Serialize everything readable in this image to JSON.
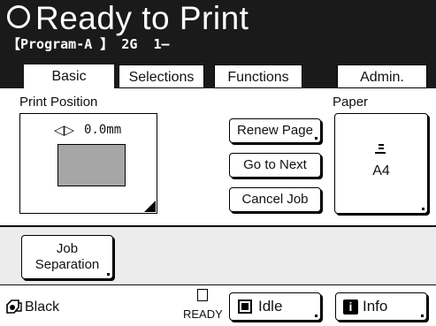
{
  "header": {
    "title": "Ready to Print",
    "subtitle": "【Program-A 】 2G  1–"
  },
  "tabs": [
    {
      "label": "Basic",
      "active": true
    },
    {
      "label": "Selections",
      "active": false
    },
    {
      "label": "Functions",
      "active": false
    },
    {
      "label": "Admin.",
      "active": false
    }
  ],
  "print_position": {
    "label": "Print Position",
    "value": "0.0mm"
  },
  "actions": {
    "renew": "Renew Page",
    "goto": "Go to Next",
    "cancel": "Cancel Job"
  },
  "paper": {
    "label": "Paper",
    "size": "A4"
  },
  "job_separation": {
    "line1": "Job",
    "line2": "Separation"
  },
  "footer": {
    "color": "Black",
    "ready": "READY",
    "idle": "Idle",
    "info": "Info"
  },
  "icons": {
    "status": "progress-circle-icon",
    "position": "left-right-arrows-icon",
    "paper": "paper-stack-icon",
    "drum": "drum-icon",
    "ready": "document-icon",
    "idle": "idle-square-icon",
    "info": "info-icon"
  },
  "colors": {
    "header_bg": "#1a1a1a",
    "preview_gray": "#a6a6a6",
    "band_bg": "#ececec"
  }
}
